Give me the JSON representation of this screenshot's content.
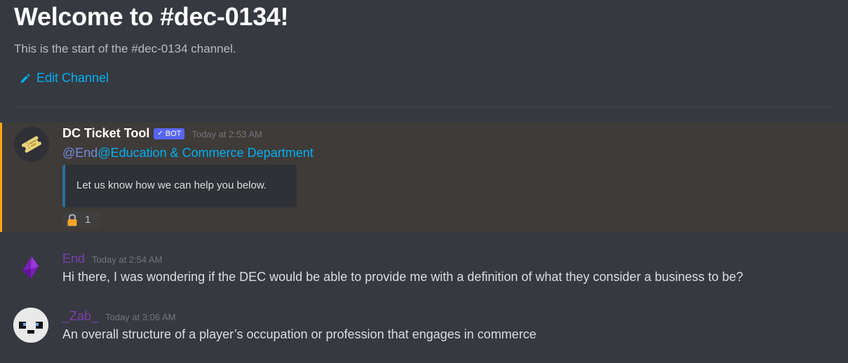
{
  "welcome": {
    "title": "Welcome to #dec-0134!",
    "subtitle": "This is the start of the #dec-0134 channel.",
    "edit_channel_label": "Edit Channel"
  },
  "messages": [
    {
      "username": "DC Ticket Tool",
      "username_color": "#ffffff",
      "bot_tag": "BOT",
      "timestamp": "Today at 2:53 AM",
      "mention_user": "@End",
      "mention_role": "@Education & Commerce Department",
      "embed_text": "Let us know how we can help you below.",
      "reaction": {
        "emoji": "lock-icon",
        "count": "1"
      },
      "highlighted": true
    },
    {
      "username": "End",
      "username_color": "#7b3fae",
      "timestamp": "Today at 2:54 AM",
      "text": "Hi there, I was wondering if the DEC would be able to provide me with a definition of what they consider a business to be?"
    },
    {
      "username": "_Zab_",
      "username_color": "#7b3fae",
      "timestamp": "Today at 3:06 AM",
      "text": "An overall structure of a player’s occupation or profession that engages in commerce"
    }
  ],
  "colors": {
    "background": "#36393f",
    "accent_link": "#00aff4",
    "highlight_bar": "#faa61a",
    "bot_tag": "#5865f2"
  }
}
